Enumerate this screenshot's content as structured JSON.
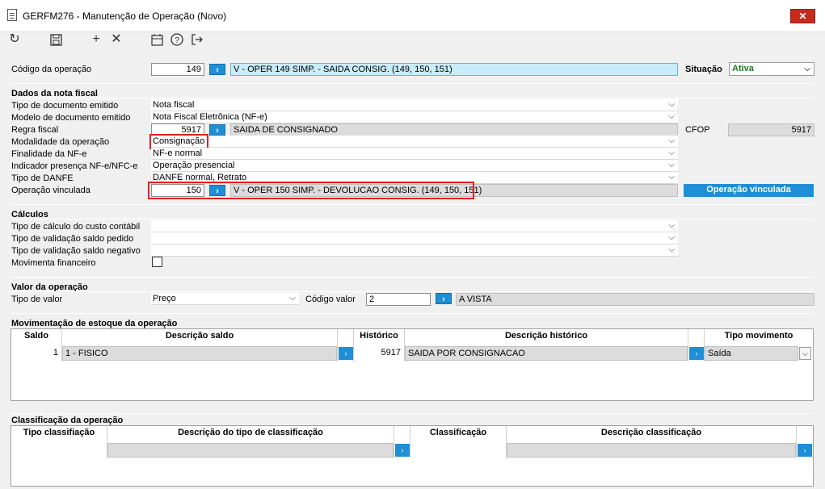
{
  "window": {
    "title": "GERFM276 - Manutenção de Operação (Novo)",
    "close_label": "✕"
  },
  "toolbar": {
    "refresh_icon": "refresh-icon",
    "save_icon": "save-icon",
    "add_icon": "add-icon",
    "cancel_icon": "cancel-icon",
    "calendar_icon": "calendar-icon",
    "help_icon": "help-icon",
    "exit_icon": "exit-icon"
  },
  "operacao": {
    "codigo_label": "Código da operação",
    "codigo_value": "149",
    "descricao_value": "V - OPER 149 SIMP. - SAIDA CONSIG. (149, 150, 151)",
    "situacao_label": "Situação",
    "situacao_value": "Ativa"
  },
  "dados_nota": {
    "title": "Dados da nota fiscal",
    "tipo_doc_label": "Tipo de documento emitido",
    "tipo_doc_value": "Nota fiscal",
    "modelo_doc_label": "Modelo de documento emitido",
    "modelo_doc_value": "Nota Fiscal Eletrônica (NF-e)",
    "regra_fiscal_label": "Regra fiscal",
    "regra_fiscal_code": "5917",
    "regra_fiscal_desc": "SAIDA DE CONSIGNADO",
    "cfop_label": "CFOP",
    "cfop_value": "5917",
    "modalidade_label": "Modalidade da operação",
    "modalidade_value": "Consignação",
    "finalidade_label": "Finalidade da NF-e",
    "finalidade_value": "NF-e normal",
    "indicador_label": "Indicador presença NF-e/NFC-e",
    "indicador_value": "Operação presencial",
    "danfe_label": "Tipo de DANFE",
    "danfe_value": "DANFE normal, Retrato",
    "vinculada_label": "Operação vinculada",
    "vinculada_code": "150",
    "vinculada_desc": "V - OPER 150 SIMP. - DEVOLUCAO CONSIG. (149, 150, 151)",
    "vinculada_button": "Operação vinculada"
  },
  "calculos": {
    "title": "Cálculos",
    "custo_label": "Tipo de cálculo do custo contábil",
    "saldo_pedido_label": "Tipo de validação saldo pedido",
    "saldo_negativo_label": "Tipo de validação saldo negativo",
    "movimenta_label": "Movimenta financeiro"
  },
  "valor": {
    "title": "Valor da operação",
    "tipo_label": "Tipo de valor",
    "tipo_value": "Preço",
    "codigo_label": "Código valor",
    "codigo_value": "2",
    "codigo_desc": "A VISTA"
  },
  "estoque": {
    "title": "Movimentação de estoque da operação",
    "columns": [
      "Saldo",
      "Descrição saldo",
      "Histórico",
      "Descrição histórico",
      "Tipo movimento"
    ],
    "row": {
      "saldo": "1",
      "descricao_saldo": "1 - FISICO",
      "historico": "5917",
      "descricao_historico": "SAIDA POR CONSIGNACAO",
      "tipo_movimento": "Saída"
    }
  },
  "classificacao": {
    "title": "Classificação da operação",
    "columns": [
      "Tipo classifiação",
      "Descrição do tipo de classificação",
      "Classificação",
      "Descrição classificação"
    ]
  },
  "colors": {
    "accent": "#1e8fd6",
    "highlight": "#e02020",
    "selection": "#c9ecfa",
    "ativa_text": "#1a7a1a"
  }
}
